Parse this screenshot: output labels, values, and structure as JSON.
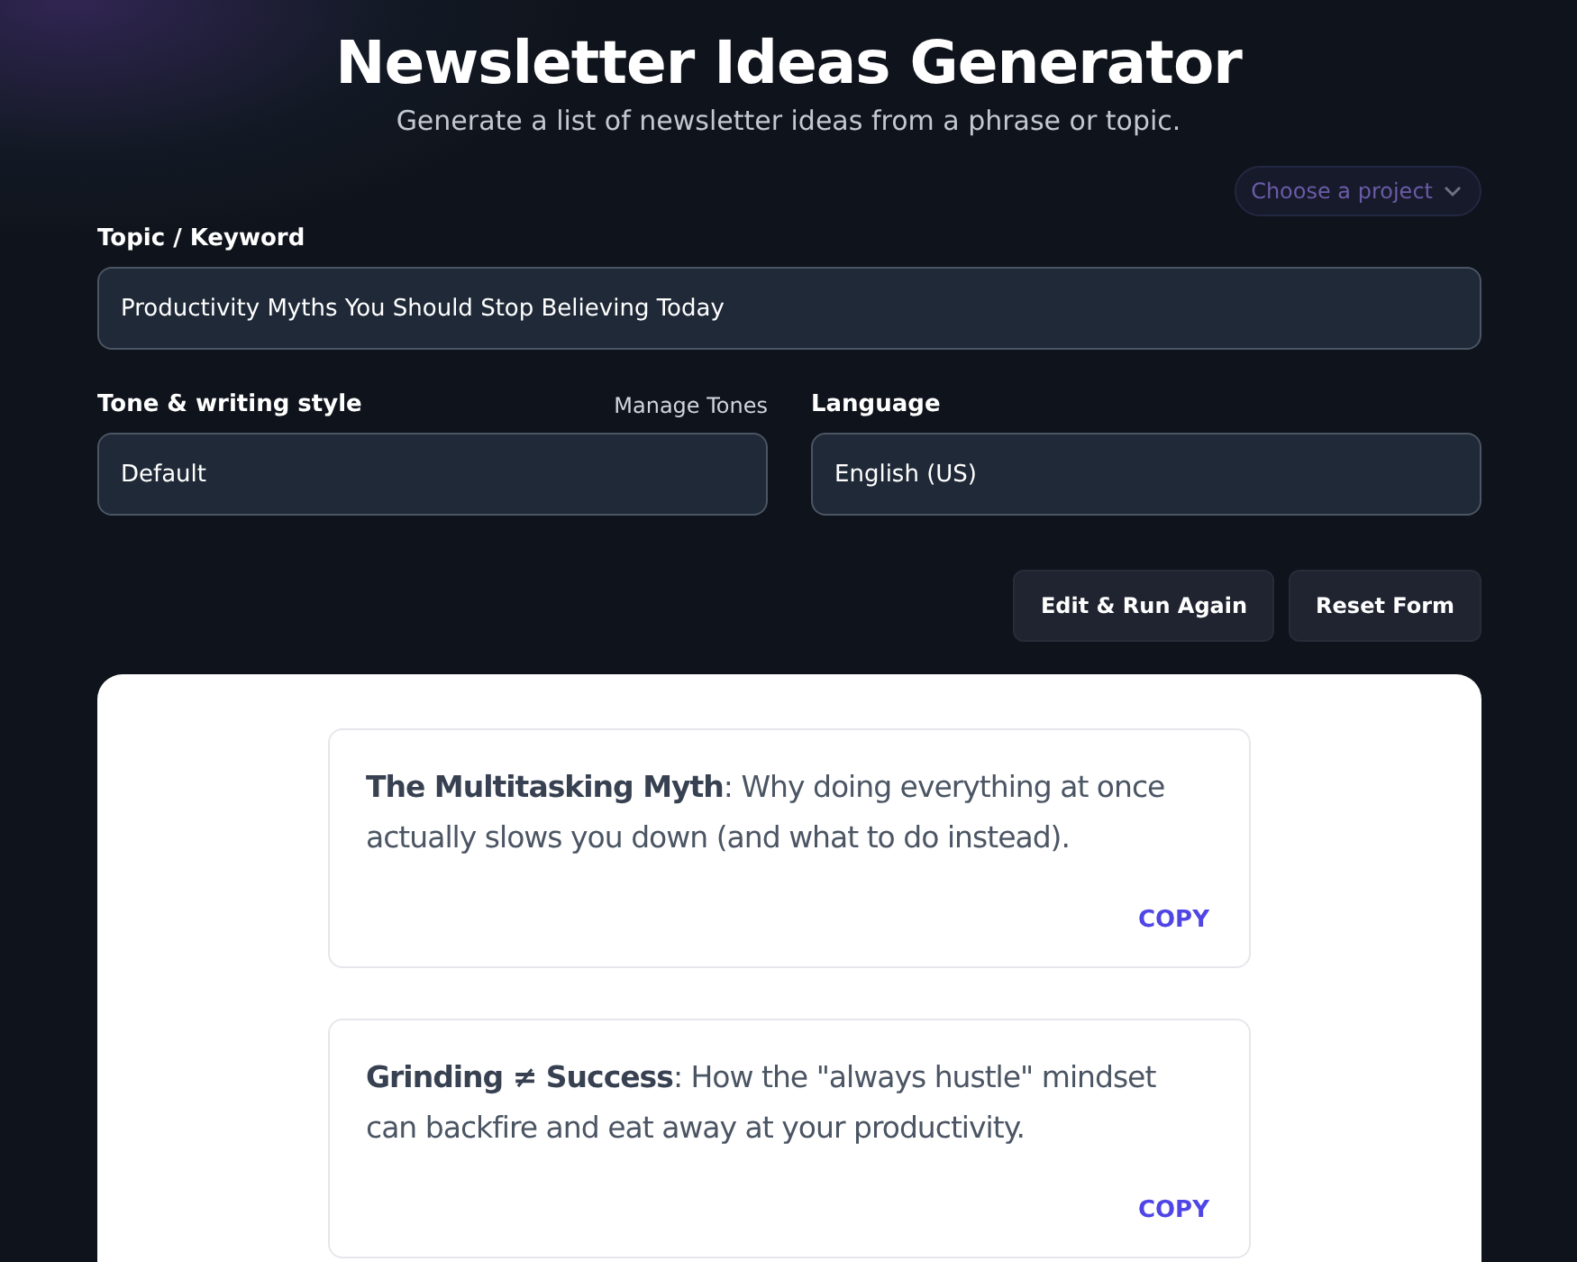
{
  "header": {
    "title": "Newsletter Ideas Generator",
    "subtitle": "Generate a list of newsletter ideas from a phrase or topic."
  },
  "project_select": {
    "placeholder": "Choose a project"
  },
  "fields": [
    {
      "label": "Topic / Keyword",
      "value": "Productivity Myths You Should Stop Believing Today"
    },
    {
      "label": "Tone & writing style",
      "value": "Default",
      "link": "Manage Tones"
    },
    {
      "label": "Language",
      "value": "English (US)"
    }
  ],
  "buttons": [
    "Edit & Run Again",
    "Reset Form"
  ],
  "ideas": [
    {
      "text": "**The Multitasking Myth**: Why doing everything at once actually slows you down (and what to do instead).",
      "action": "COPY"
    },
    {
      "text": "**Grinding ≠ Success**: How the \"always hustle\" mindset can backfire and eat away at your productivity.",
      "action": "COPY"
    }
  ]
}
